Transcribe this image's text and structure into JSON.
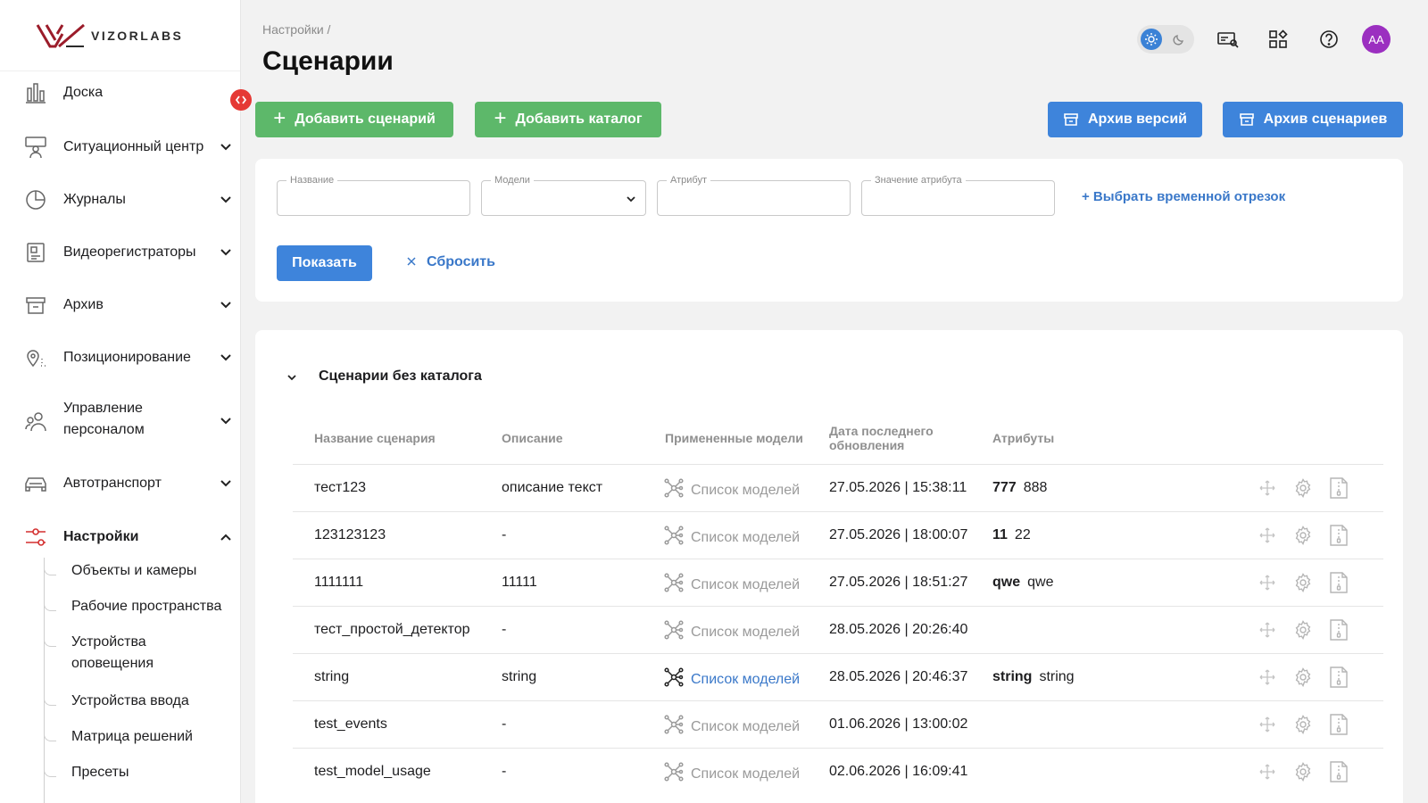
{
  "brand": {
    "logo_text": "VIZORLABS"
  },
  "sidebar": {
    "items": [
      {
        "label": "Доска",
        "icon": "dashboard-chart-icon",
        "has_chevron": false
      },
      {
        "label": "Ситуационный центр",
        "icon": "situation-center-icon",
        "has_chevron": true
      },
      {
        "label": "Журналы",
        "icon": "journals-pie-icon",
        "has_chevron": true
      },
      {
        "label": "Видеорегистраторы",
        "icon": "video-recorder-icon",
        "has_chevron": true
      },
      {
        "label": "Архив",
        "icon": "archive-box-icon",
        "has_chevron": true
      },
      {
        "label": "Позиционирование",
        "icon": "location-pin-icon",
        "has_chevron": true
      },
      {
        "label": "Управление персоналом",
        "icon": "personnel-icon",
        "has_chevron": true
      },
      {
        "label": "Автотранспорт",
        "icon": "car-icon",
        "has_chevron": true
      },
      {
        "label": "Настройки",
        "icon": "settings-sliders-icon",
        "has_chevron": true,
        "active": true
      }
    ],
    "sub_items": [
      "Объекты и камеры",
      "Рабочие пространства",
      "Устройства оповещения",
      "Устройства ввода",
      "Матрица решений",
      "Пресеты"
    ]
  },
  "header": {
    "breadcrumb": "Настройки /",
    "title": "Сценарии",
    "avatar_initials": "AA"
  },
  "toolbar": {
    "add_scenario": "Добавить сценарий",
    "add_catalog": "Добавить каталог",
    "versions_archive": "Архив версий",
    "scenarios_archive": "Архив сценариев"
  },
  "filters": {
    "name_label": "Название",
    "name_value": "",
    "models_label": "Модели",
    "models_value": "",
    "attribute_label": "Атрибут",
    "attribute_value": "",
    "attribute_value_label": "Значение атрибута",
    "attribute_value_value": "",
    "time_range": "+ Выбрать временной отрезок",
    "show": "Показать",
    "reset": "Сбросить"
  },
  "table": {
    "section_title": "Сценарии без каталога",
    "columns": {
      "name": "Название сценария",
      "description": "Описание",
      "models": "Примененные модели",
      "updated": "Дата последнего обновления",
      "attributes": "Атрибуты"
    },
    "rows": [
      {
        "name": "тест123",
        "description": "описание текст",
        "models": "Список моделей",
        "models_active": false,
        "updated": "27.05.2026 | 15:38:11",
        "attr_key": "777",
        "attr_value": "888"
      },
      {
        "name": "123123123",
        "description": "-",
        "models": "Список моделей",
        "models_active": false,
        "updated": "27.05.2026 | 18:00:07",
        "attr_key": "11",
        "attr_value": "22"
      },
      {
        "name": "1111111",
        "description": "11111",
        "models": "Список моделей",
        "models_active": false,
        "updated": "27.05.2026 | 18:51:27",
        "attr_key": "qwe",
        "attr_value": "qwe"
      },
      {
        "name": "тест_простой_детектор",
        "description": "-",
        "models": "Список моделей",
        "models_active": false,
        "updated": "28.05.2026 | 20:26:40",
        "attr_key": "",
        "attr_value": ""
      },
      {
        "name": "string",
        "description": "string",
        "models": "Список моделей",
        "models_active": true,
        "updated": "28.05.2026 | 20:46:37",
        "attr_key": "string",
        "attr_value": "string"
      },
      {
        "name": "test_events",
        "description": "-",
        "models": "Список моделей",
        "models_active": false,
        "updated": "01.06.2026 | 13:00:02",
        "attr_key": "",
        "attr_value": ""
      },
      {
        "name": "test_model_usage",
        "description": "-",
        "models": "Список моделей",
        "models_active": false,
        "updated": "02.06.2026 | 16:09:41",
        "attr_key": "",
        "attr_value": ""
      }
    ]
  },
  "colors": {
    "accent_blue": "#3e84db",
    "accent_green": "#5db86a",
    "link_blue": "#3a78c9",
    "collapse_red": "#e53935",
    "avatar_purple": "#9b2fc0"
  }
}
